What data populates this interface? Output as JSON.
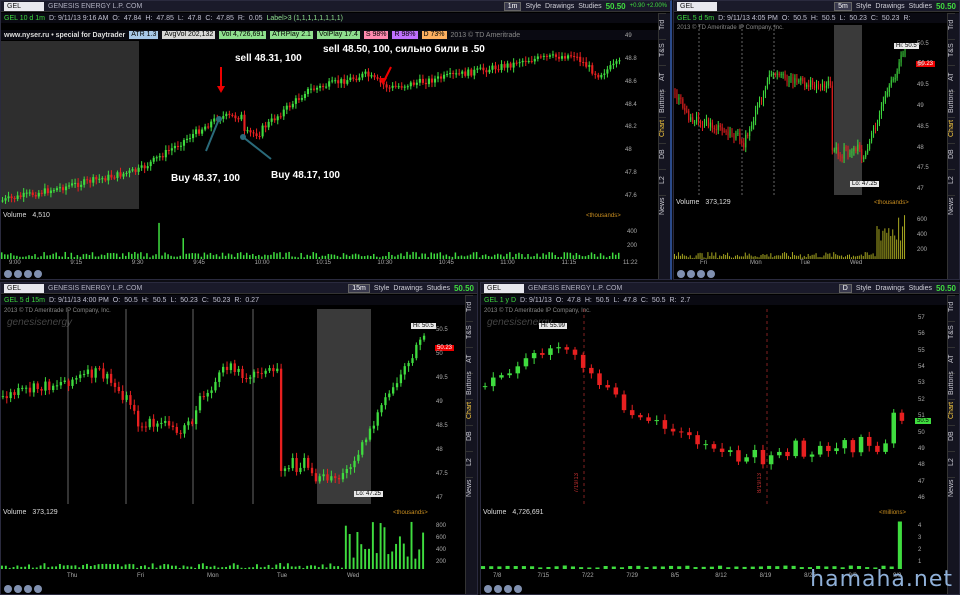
{
  "top_left": {
    "symbol": "GEL",
    "company": "GENESIS ENERGY L.P. COM",
    "timeframe": "1m",
    "style": "Style",
    "drawings": "Drawings",
    "studies": "Studies",
    "price": "50.50",
    "change": "+0.90 +2.00%",
    "info": [
      "GEL 10 d 1m",
      "D: 9/11/13 9:16 AM",
      "O:",
      "47.84",
      "H:",
      "47.85",
      "L:",
      "47.8",
      "C:",
      "47.85",
      "R:",
      "0.05",
      "Label>3 (1,1,1,1,1,1,1,1)"
    ],
    "site": "www.nyser.ru • special for Daytrader",
    "badges": [
      "ATR 1.3",
      "AvgVol 202,132",
      "Vol 4,726,691",
      "ATRPlay 2.1",
      "VolPlay 17.4",
      "S 98%",
      "R 98%",
      "D 73%"
    ],
    "copyright": "2013 © TD Ameritrade",
    "watermark": "genesisenergy",
    "annotations": {
      "sell1": "sell 48.31, 100",
      "sell2": "sell 48.50, 100, сильно били в .50",
      "buy1": "Buy  48.37, 100",
      "buy2": "Buy  48.17, 100"
    },
    "y_ticks": [
      "49",
      "48.8",
      "48.6",
      "48.4",
      "48.2",
      "48",
      "47.8",
      "47.6"
    ],
    "volume_label": "Volume",
    "volume_value": "4,510",
    "volume_unit": "<thousands>",
    "vol_ticks": [
      "400",
      "200"
    ],
    "x_ticks": [
      "9:00",
      "9:15",
      "9:30",
      "9:45",
      "10:00",
      "10:15",
      "10:30",
      "10:45",
      "11:00",
      "11:15",
      "11:22"
    ]
  },
  "top_right": {
    "symbol": "GEL",
    "timeframe": "5m",
    "style": "Style",
    "drawings": "Drawings",
    "studies": "Studies",
    "price": "50.50",
    "change": "+0.90 +2.00%",
    "info": [
      "GEL 5 d 5m",
      "D: 9/11/13 4:05 PM",
      "O:",
      "50.5",
      "H:",
      "50.5",
      "L:",
      "50.23",
      "C:",
      "50.23",
      "R:"
    ],
    "copyright": "2013 © TD Ameritrade IP Company, Inc.",
    "hi": "Hi: 50.5",
    "lo": "Lo: 47.25",
    "last": "50.23",
    "y_ticks": [
      "50.5",
      "50",
      "49.5",
      "49",
      "48.5",
      "48",
      "47.5",
      "47"
    ],
    "volume_label": "Volume",
    "volume_value": "373,129",
    "volume_unit": "<thousands>",
    "vol_ticks": [
      "600",
      "400",
      "200"
    ],
    "x_ticks": [
      "Fri",
      "Mon",
      "Tue",
      "Wed"
    ]
  },
  "bottom_left": {
    "symbol": "GEL",
    "company": "GENESIS ENERGY L.P. COM",
    "timeframe": "15m",
    "style": "Style",
    "drawings": "Drawings",
    "studies": "Studies",
    "price": "50.50",
    "change": "+0.90 +2.00%",
    "info": [
      "GEL 5 d 15m",
      "D: 9/11/13 4:00 PM",
      "O:",
      "50.5",
      "H:",
      "50.5",
      "L:",
      "50.23",
      "C:",
      "50.23",
      "R:",
      "0.27"
    ],
    "copyright": "2013 © TD Ameritrade IP Company, Inc.",
    "watermark": "genesisenergy",
    "hi": "Hi: 50.5",
    "lo": "Lo: 47.25",
    "last": "50.23",
    "y_ticks": [
      "50.5",
      "50",
      "49.5",
      "49",
      "48.5",
      "48",
      "47.5",
      "47"
    ],
    "volume_label": "Volume",
    "volume_value": "373,129",
    "volume_unit": "<thousands>",
    "vol_ticks": [
      "800",
      "600",
      "400",
      "200"
    ],
    "x_ticks": [
      "Thu",
      "Fri",
      "Mon",
      "Tue",
      "Wed"
    ]
  },
  "bottom_right": {
    "symbol": "GEL",
    "company": "GENESIS ENERGY L.P. COM",
    "timeframe": "D",
    "style": "Style",
    "drawings": "Drawings",
    "studies": "Studies",
    "price": "50.50",
    "change": "+0.90 +2.00%",
    "info": [
      "GEL 1 y D",
      "D: 9/11/13",
      "O:",
      "47.8",
      "H:",
      "50.5",
      "L:",
      "47.8",
      "C:",
      "50.5",
      "R:",
      "2.7"
    ],
    "copyright": "2013 © TD Ameritrade IP Company, Inc.",
    "watermark": "genesisenergy",
    "hi": "Hi: 55.99",
    "last": "50.5",
    "events": [
      "7/19/13",
      "8/19/13"
    ],
    "y_ticks": [
      "57",
      "56",
      "55",
      "54",
      "53",
      "52",
      "51",
      "50",
      "49",
      "48",
      "47",
      "46"
    ],
    "volume_label": "Volume",
    "volume_value": "4,726,691",
    "volume_unit": "<millions>",
    "vol_ticks": [
      "4",
      "3",
      "2",
      "1"
    ],
    "x_ticks": [
      "7/8",
      "7/15",
      "7/22",
      "7/29",
      "8/5",
      "8/12",
      "8/19",
      "8/26",
      "9/3",
      "9/9"
    ]
  },
  "side_tabs": [
    "Trd",
    "T&S",
    "AT",
    "Buttons",
    "Chart",
    "DB",
    "L2",
    "News"
  ],
  "watermark_site": "hamaha.net"
}
